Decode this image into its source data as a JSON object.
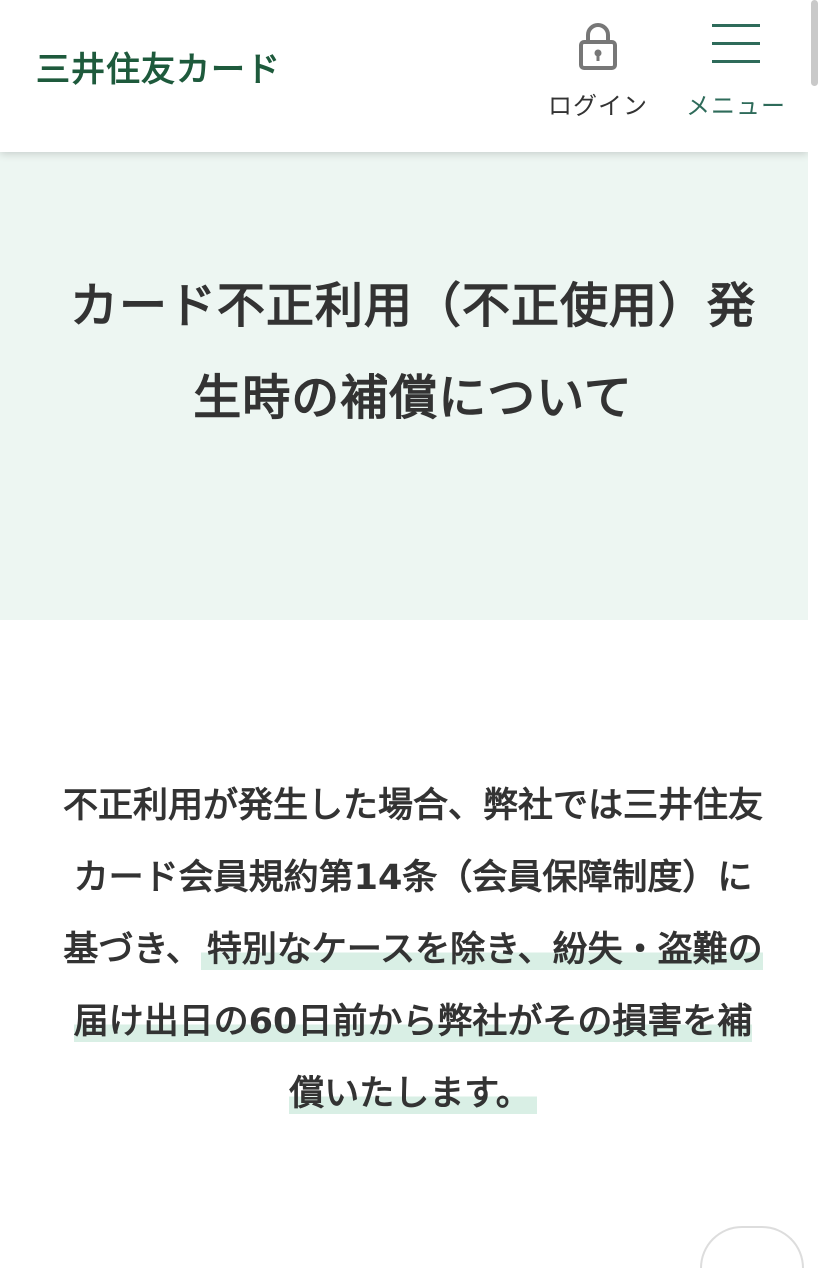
{
  "header": {
    "logo": "三井住友カード",
    "login_label": "ログイン",
    "menu_label": "メニュー"
  },
  "hero": {
    "title": "カード不正利用（不正使用）発生時の補償について"
  },
  "content": {
    "text_plain": "不正利用が発生した場合、弊社では三井住友カード会員規約第14条（会員保障制度）に基づき、",
    "text_highlight": "特別なケースを除き、紛失・盗難の届け出日の60日前から弊社がその損害を補償いたします。"
  },
  "colors": {
    "brand_green": "#1e5a3c",
    "menu_green": "#2e6b5a",
    "hero_bg": "#edf6f2",
    "highlight": "#d9efe5"
  },
  "icons": [
    "lock-icon",
    "hamburger-menu-icon"
  ]
}
